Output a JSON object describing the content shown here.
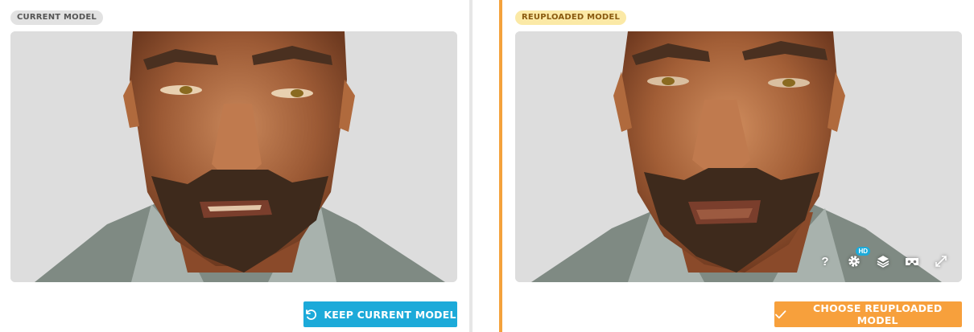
{
  "current": {
    "badge": "CURRENT MODEL",
    "button_label": "KEEP CURRENT MODEL",
    "button_icon": "undo-icon"
  },
  "reuploaded": {
    "badge": "REUPLOADED MODEL",
    "button_label": "CHOOSE REUPLOADED MODEL",
    "button_icon": "check-icon"
  },
  "toolbar": {
    "help_label": "?",
    "hd_label": "HD",
    "icons": [
      "help-icon",
      "settings-icon",
      "layers-icon",
      "vr-icon",
      "fullscreen-icon"
    ]
  },
  "colors": {
    "keep_button": "#1caad9",
    "choose_button": "#f7a03c",
    "active_divider": "#f4a23c",
    "reuploaded_badge_bg": "#fbe9a6",
    "current_badge_bg": "#e2e2e2",
    "viewer_bg": "#dddddd"
  }
}
